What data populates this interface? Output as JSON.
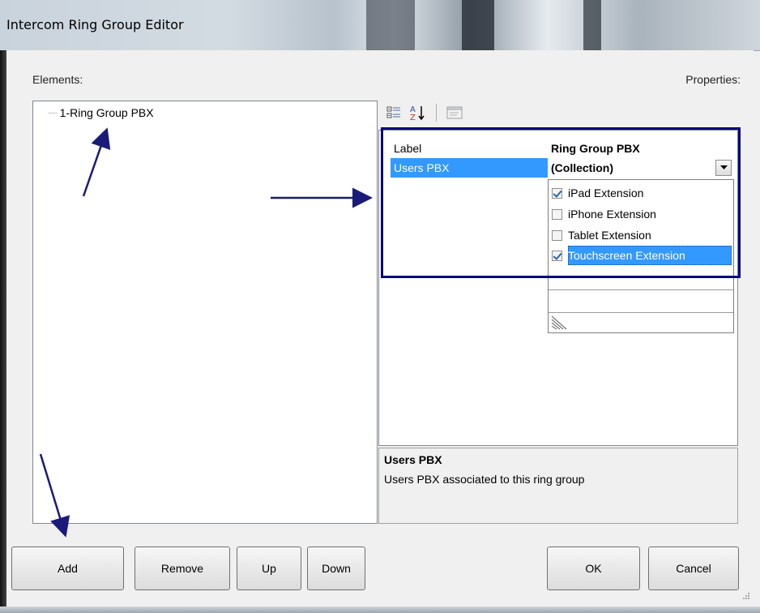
{
  "window": {
    "title": "Intercom Ring Group Editor"
  },
  "elements_label": "Elements:",
  "properties_label": "Properties:",
  "tree": {
    "items": [
      {
        "label": "1-Ring Group PBX"
      }
    ]
  },
  "toolbar": {
    "icons": [
      "categorized-icon",
      "alphabetical-sort-icon",
      "property-pages-icon"
    ]
  },
  "property_grid": {
    "rows": [
      {
        "name": "Label",
        "value": "Ring Group PBX",
        "selected": false
      },
      {
        "name": "Users PBX",
        "value": "(Collection)",
        "selected": true
      }
    ]
  },
  "dropdown": {
    "items": [
      {
        "label": "iPad Extension",
        "checked": true,
        "selected": false
      },
      {
        "label": "iPhone Extension",
        "checked": false,
        "selected": false
      },
      {
        "label": "Tablet Extension",
        "checked": false,
        "selected": false
      },
      {
        "label": "Touchscreen Extension",
        "checked": true,
        "selected": true
      }
    ]
  },
  "description": {
    "title": "Users PBX",
    "text": "Users PBX associated to this ring group"
  },
  "buttons": {
    "add": "Add",
    "remove": "Remove",
    "up": "Up",
    "down": "Down",
    "ok": "OK",
    "cancel": "Cancel"
  },
  "colors": {
    "highlight_box": "#000080",
    "annotation_arrow": "#1a1a7a",
    "selection": "#3399ff"
  }
}
